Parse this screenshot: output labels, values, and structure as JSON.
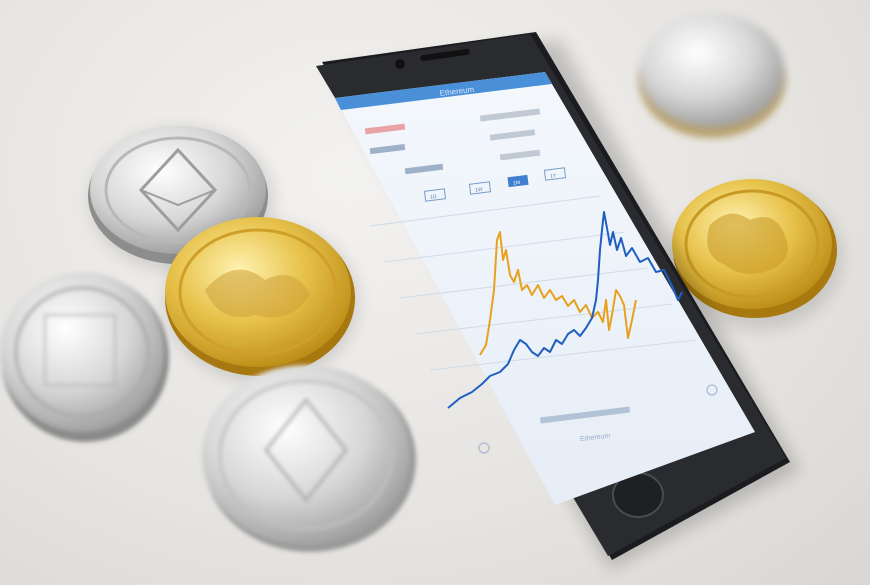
{
  "photo": {
    "background_color": "#e9e8e6",
    "subjects": [
      "smartphone",
      "silver-coins",
      "gold-coins"
    ]
  },
  "phone_screen": {
    "header_title": "Ethereum",
    "tabs": [
      "1D",
      "1W",
      "1M",
      "1Y"
    ],
    "active_tab_index": 2,
    "footer_label": "Ethereum",
    "colors": {
      "series_a": "#e8a11d",
      "series_b": "#1f5fbf",
      "header": "#4a90d9"
    }
  }
}
